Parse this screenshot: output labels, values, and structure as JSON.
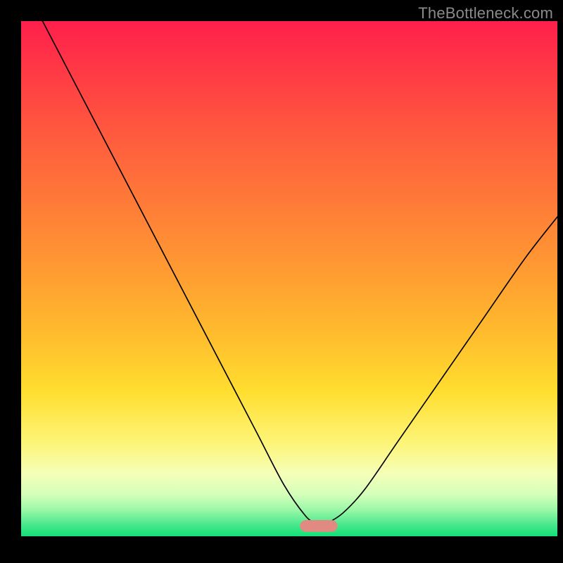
{
  "watermark": "TheBottleneck.com",
  "colors": {
    "curve": "#000000",
    "marker": "#e18a82",
    "frame": "#000000"
  },
  "chart_data": {
    "type": "line",
    "title": "",
    "xlabel": "",
    "ylabel": "",
    "xlim": [
      0,
      100
    ],
    "ylim": [
      0,
      100
    ],
    "grid": false,
    "legend": false,
    "description": "V-shaped bottleneck curve on a vertical rainbow gradient (red at top through orange, yellow, pale yellow, to green at bottom). The curve descends steeply from the upper-left, reaches a minimum near x≈55 at y≈2, then rises to the right edge at y≈62. A short horizontal pink rounded marker sits at the minimum.",
    "curve_points": [
      {
        "x": 4,
        "y": 100
      },
      {
        "x": 8,
        "y": 92
      },
      {
        "x": 14,
        "y": 80
      },
      {
        "x": 22,
        "y": 64
      },
      {
        "x": 30,
        "y": 48
      },
      {
        "x": 38,
        "y": 32
      },
      {
        "x": 44,
        "y": 20
      },
      {
        "x": 49,
        "y": 10
      },
      {
        "x": 53,
        "y": 4
      },
      {
        "x": 55,
        "y": 2.5
      },
      {
        "x": 56,
        "y": 2.2
      },
      {
        "x": 57,
        "y": 2.5
      },
      {
        "x": 60,
        "y": 4.5
      },
      {
        "x": 64,
        "y": 9
      },
      {
        "x": 70,
        "y": 18
      },
      {
        "x": 78,
        "y": 30
      },
      {
        "x": 86,
        "y": 42
      },
      {
        "x": 94,
        "y": 54
      },
      {
        "x": 100,
        "y": 62
      }
    ],
    "marker": {
      "x_center": 55.5,
      "y": 2.0,
      "width": 7,
      "height": 2.3
    }
  }
}
